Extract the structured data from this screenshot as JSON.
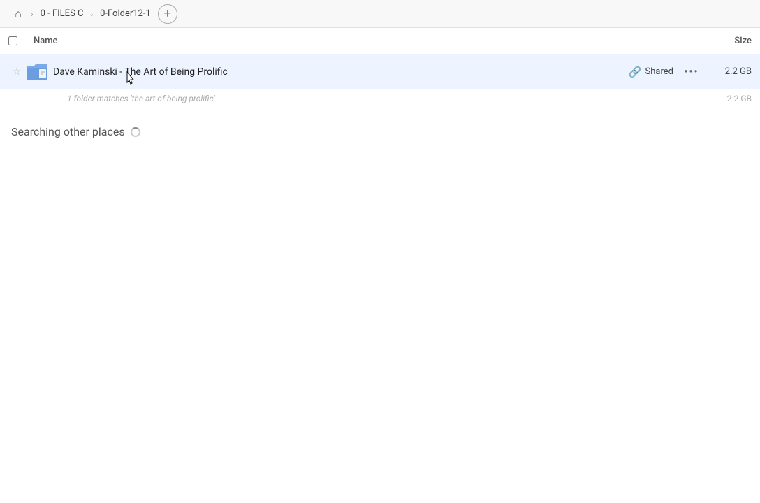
{
  "breadcrumb": {
    "home_icon": "🏠",
    "items": [
      {
        "label": "0 - FILES C",
        "id": "files-c"
      },
      {
        "label": "0-Folder12-1",
        "id": "folder12-1"
      }
    ],
    "add_label": "+"
  },
  "columns": {
    "name_label": "Name",
    "size_label": "Size"
  },
  "file_row": {
    "name": "Dave Kaminski - The Art of Being Prolific",
    "shared_label": "Shared",
    "size": "2.2 GB"
  },
  "match_info": {
    "text": "1 folder matches 'the art of being prolific'",
    "size": "2.2 GB"
  },
  "searching_section": {
    "title": "Searching other places"
  }
}
